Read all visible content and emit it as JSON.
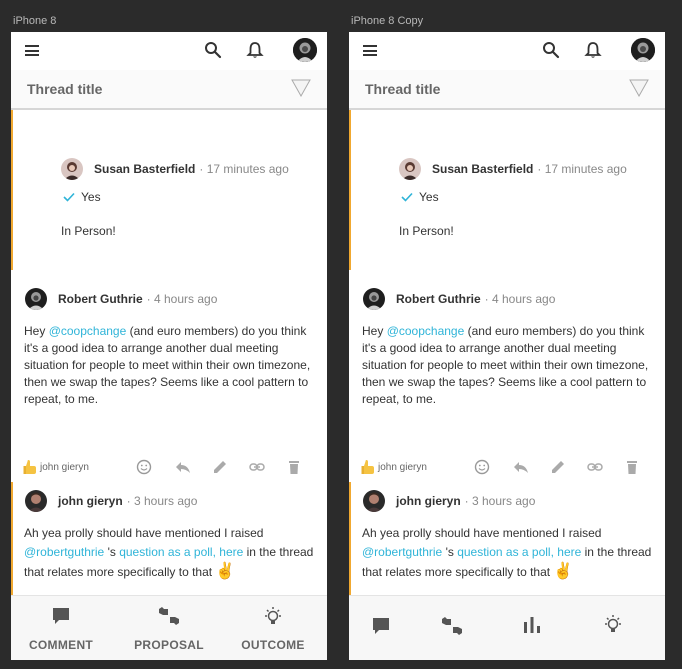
{
  "artboards": [
    {
      "label": "iPhone 8"
    },
    {
      "label": "iPhone 8 Copy"
    }
  ],
  "thread": {
    "title": "Thread title"
  },
  "vote_card": {
    "author": "Susan Basterfield",
    "time": "· 17 minutes ago",
    "choice": "Yes",
    "statement": "In Person!"
  },
  "post1": {
    "author": "Robert Guthrie",
    "time": "· 4 hours ago",
    "body_pre": "Hey ",
    "mention": "@coopchange",
    "body_post": " (and euro members) do you think it's a good idea to arrange another dual meeting situation for people to meet within their own timezone, then we swap the tapes? Seems like a cool pattern to repeat, to me.",
    "reaction_user": "john gieryn"
  },
  "post2": {
    "author": "john gieryn",
    "time": "· 3 hours ago",
    "line1": "Ah yea prolly should have mentioned I raised",
    "mention": "@robertguthrie",
    "mid": " 's ",
    "link": "question as a poll, here",
    "tail": " in the thread that relates more specifically to that ",
    "emoji": "✌"
  },
  "bottom_nav": {
    "comment": "COMMENT",
    "proposal": "PROPOSAL",
    "outcome": "OUTCOME"
  },
  "colors": {
    "accent": "#f0a830",
    "mention": "#2fb4d8",
    "check": "#2fb4d8"
  }
}
